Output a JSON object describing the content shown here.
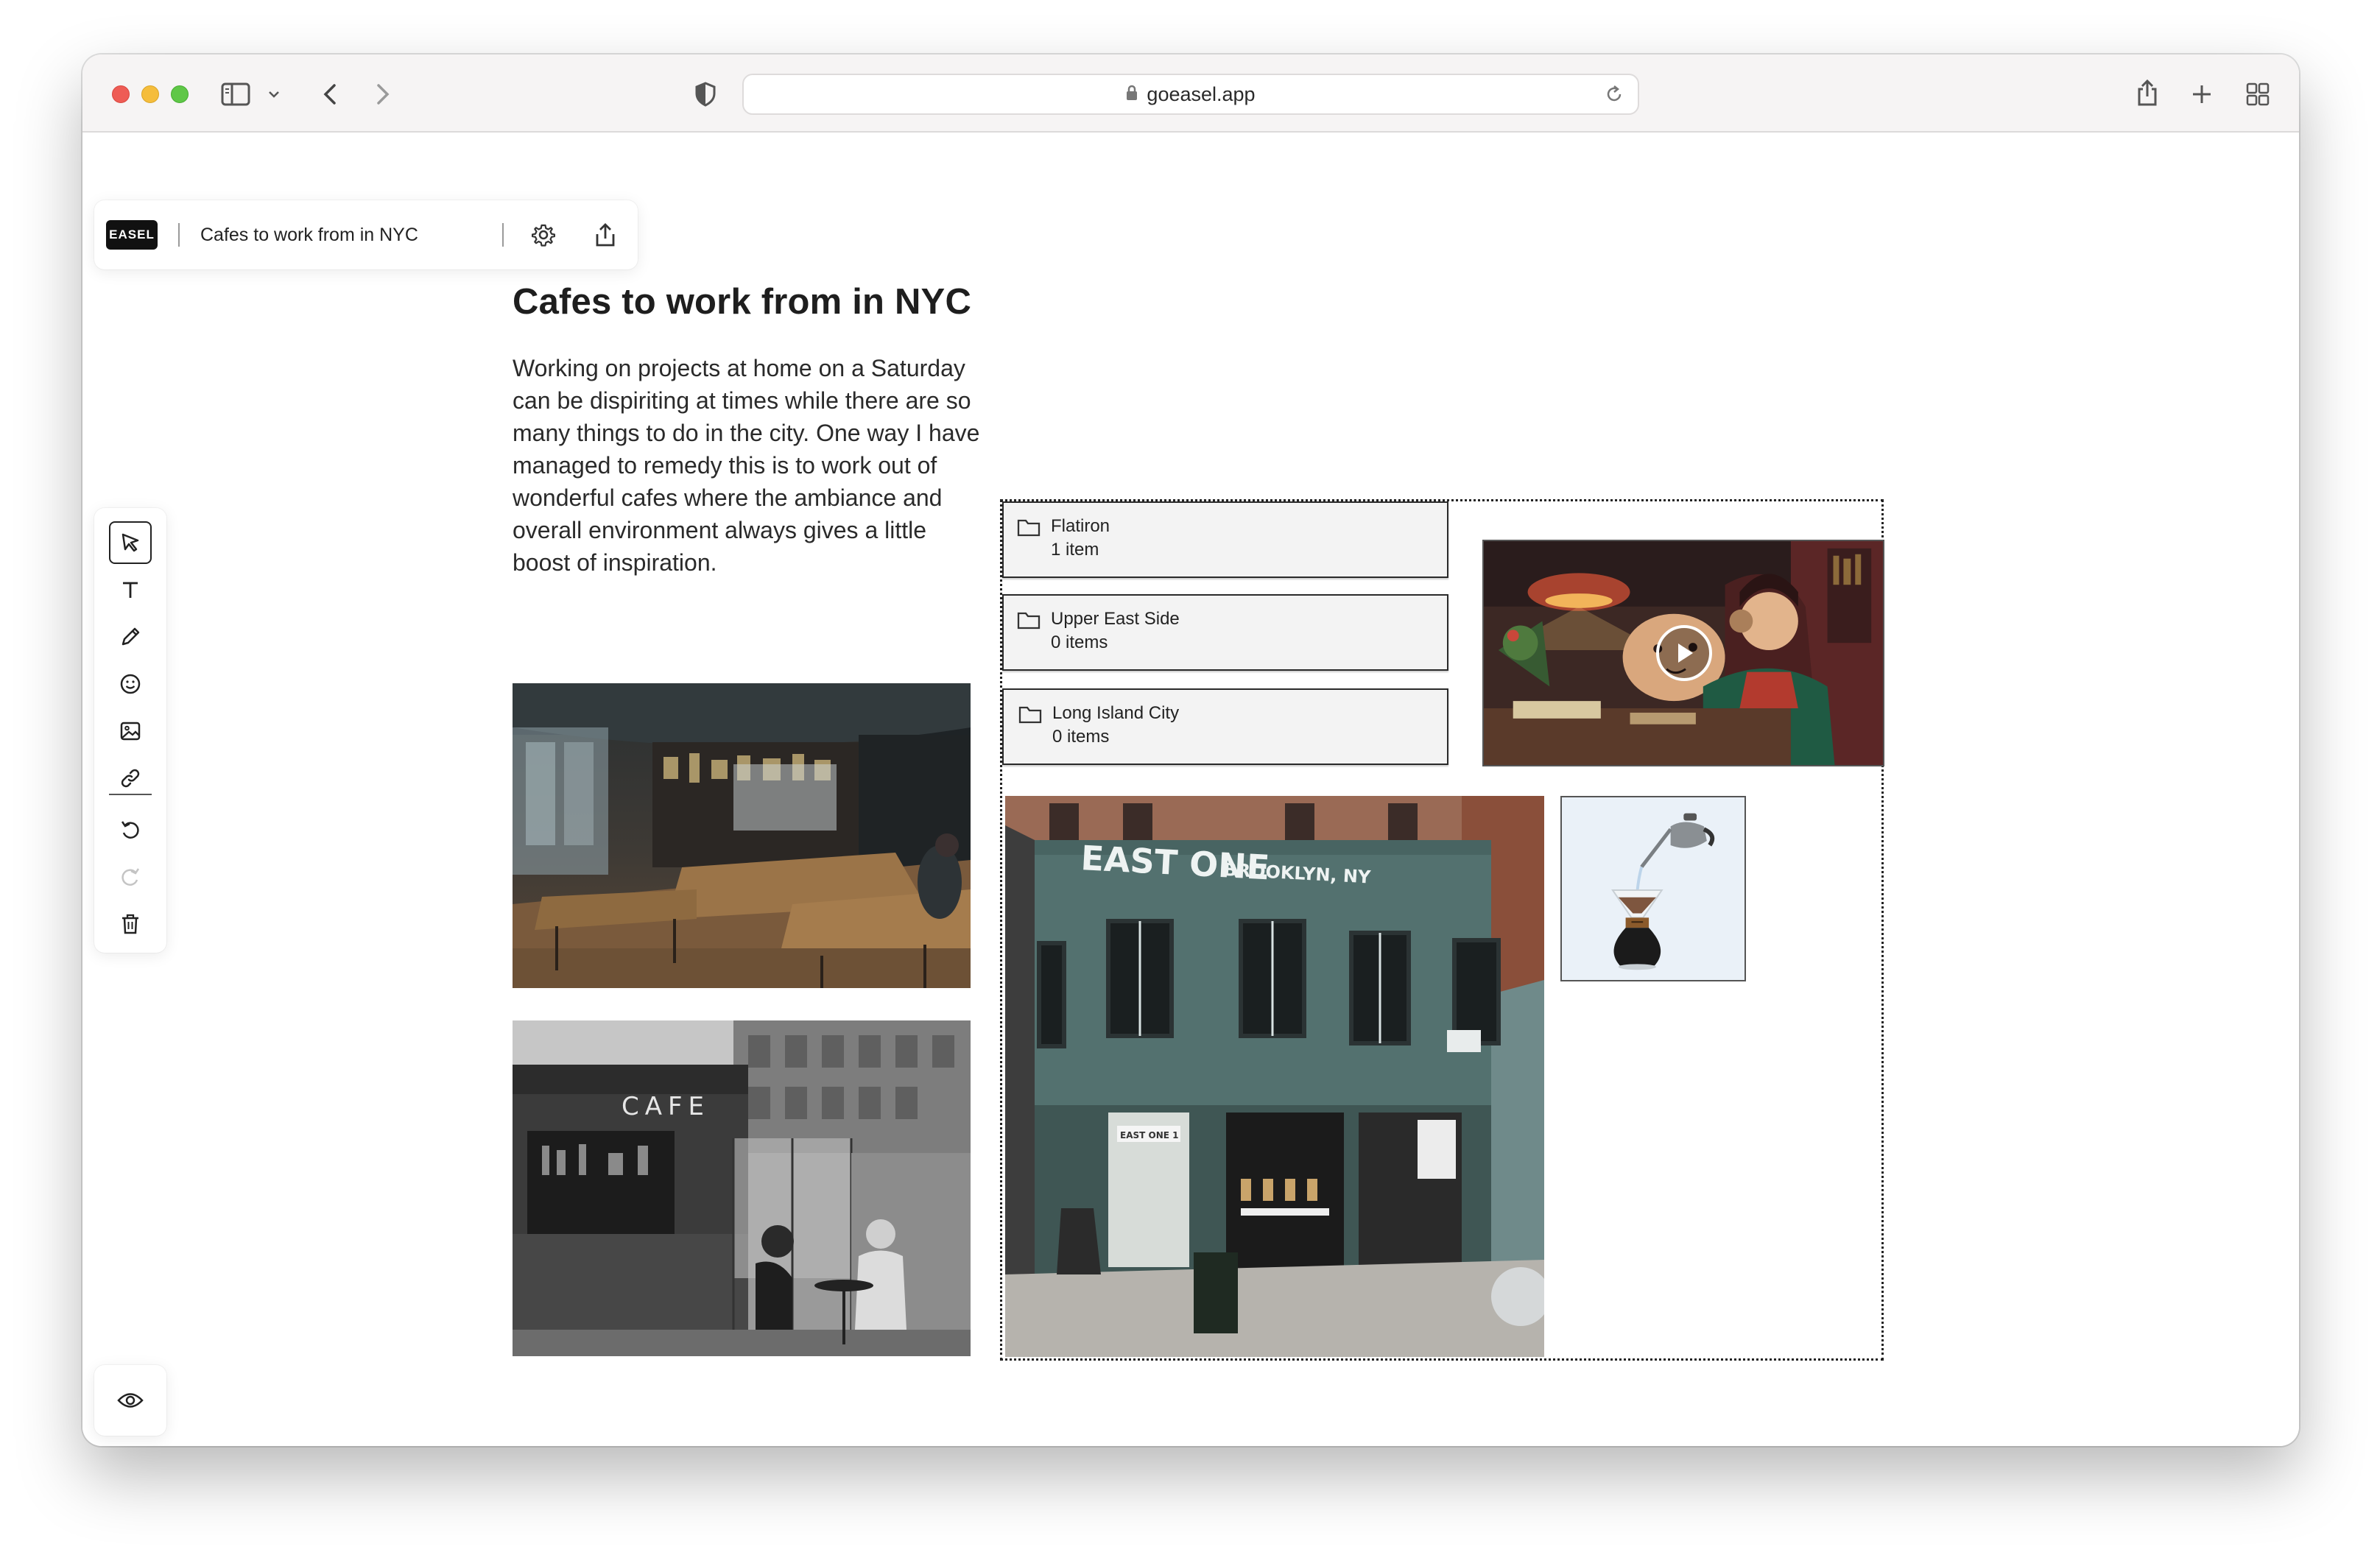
{
  "browser": {
    "url": "goeasel.app"
  },
  "appbar": {
    "logo": "EASEL",
    "doc_title": "Cafes to work from in NYC"
  },
  "article": {
    "title": "Cafes to work from in NYC",
    "body": "Working on projects at home on a Saturday can be dispiriting at times while there are so many things to do in the city. One way I have managed to remedy this is to work out of wonderful cafes where the ambiance and overall environment always gives a little boost of inspiration."
  },
  "folders": [
    {
      "name": "Flatiron",
      "count": "1 item"
    },
    {
      "name": "Upper East Side",
      "count": "0 items"
    },
    {
      "name": "Long Island City",
      "count": "0 items"
    }
  ],
  "photos": {
    "cafe_sign": "CAFE",
    "storefront_sign": "EAST ONE",
    "storefront_sub": "BROOKLYN, NY",
    "door_sign": "EAST ONE 1"
  },
  "tools": [
    "cursor-icon",
    "text-icon",
    "pencil-icon",
    "emoji-icon",
    "image-icon",
    "link-icon",
    "undo-icon",
    "redo-icon",
    "trash-icon"
  ]
}
